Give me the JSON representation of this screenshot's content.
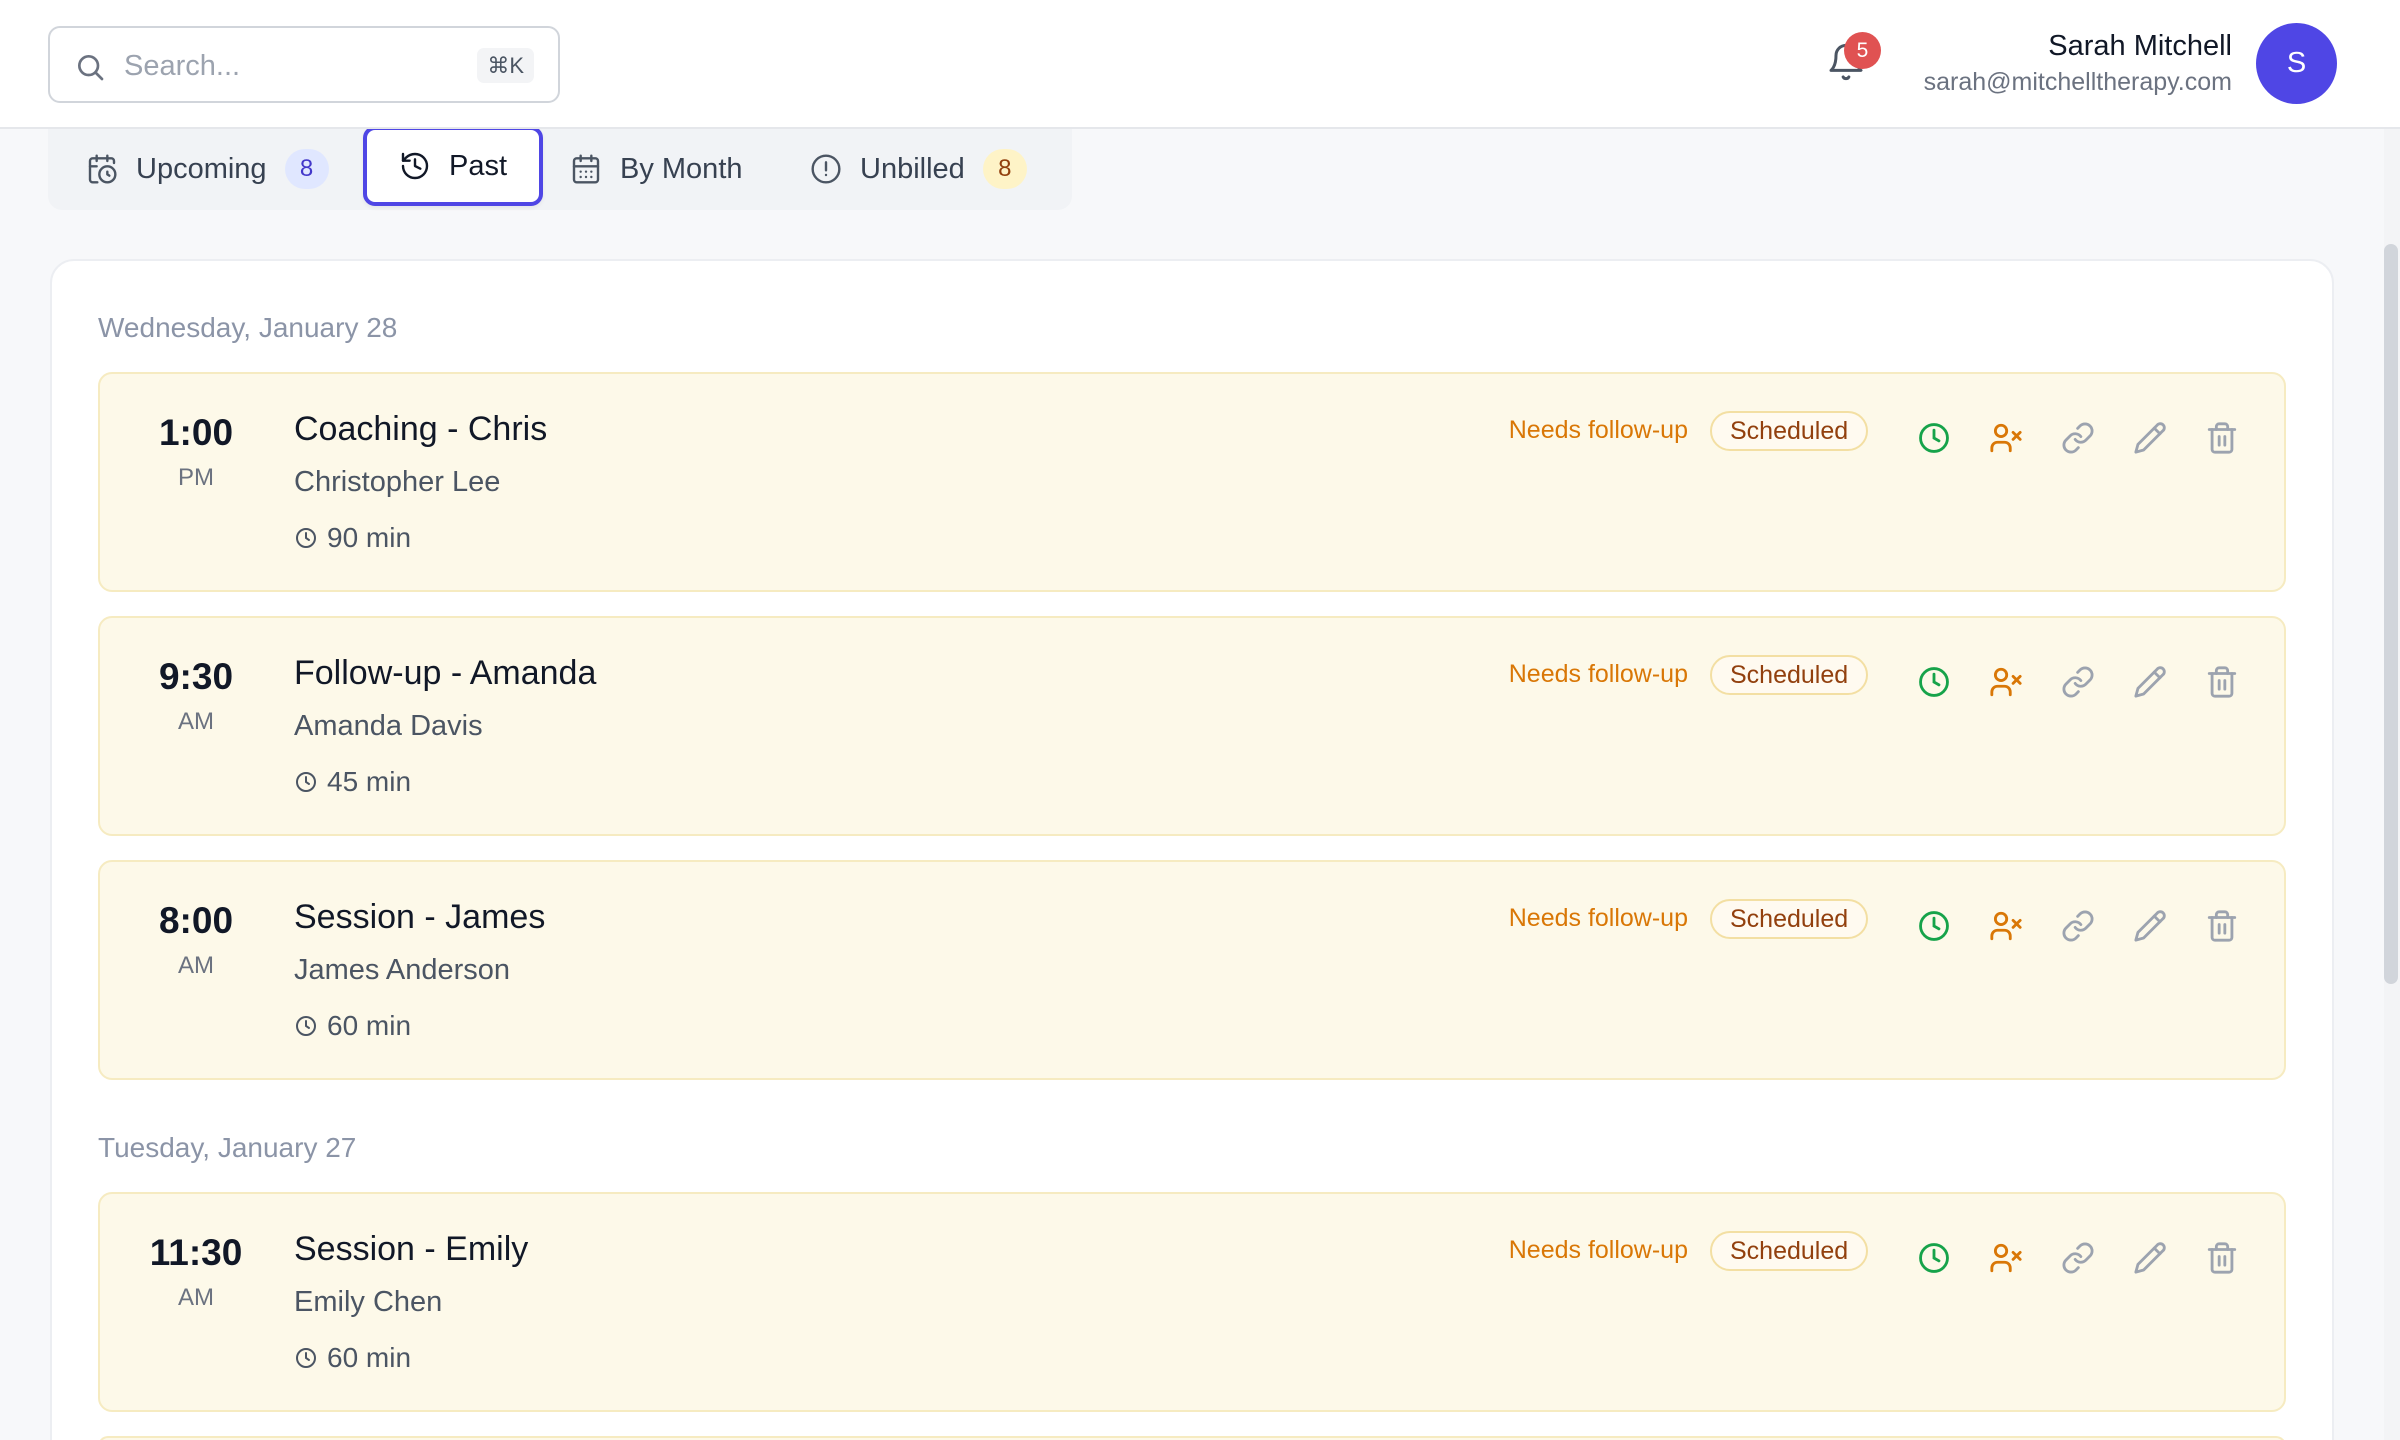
{
  "header": {
    "search_placeholder": "Search...",
    "search_shortcut": "⌘K",
    "notification_count": "5",
    "user_name": "Sarah Mitchell",
    "user_email": "sarah@mitchelltherapy.com",
    "avatar_initial": "S"
  },
  "tabs": [
    {
      "label": "Upcoming",
      "count": "8",
      "icon": "calendar-clock-icon"
    },
    {
      "label": "Past",
      "icon": "history-icon",
      "active": true
    },
    {
      "label": "By Month",
      "icon": "calendar-icon"
    },
    {
      "label": "Unbilled",
      "count": "8",
      "icon": "alert-circle-icon"
    }
  ],
  "groups": [
    {
      "date": "Wednesday, January 28",
      "sessions": [
        {
          "time": "1:00",
          "ampm": "PM",
          "title": "Coaching - Chris",
          "client": "Christopher Lee",
          "duration": "90 min",
          "flag": "Needs follow-up",
          "status": "Scheduled"
        },
        {
          "time": "9:30",
          "ampm": "AM",
          "title": "Follow-up - Amanda",
          "client": "Amanda Davis",
          "duration": "45 min",
          "flag": "Needs follow-up",
          "status": "Scheduled"
        },
        {
          "time": "8:00",
          "ampm": "AM",
          "title": "Session - James",
          "client": "James Anderson",
          "duration": "60 min",
          "flag": "Needs follow-up",
          "status": "Scheduled"
        }
      ]
    },
    {
      "date": "Tuesday, January 27",
      "sessions": [
        {
          "time": "11:30",
          "ampm": "AM",
          "title": "Session - Emily",
          "client": "Emily Chen",
          "duration": "60 min",
          "flag": "Needs follow-up",
          "status": "Scheduled"
        }
      ]
    }
  ],
  "colors": {
    "accent": "#4f46e5",
    "card_bg": "#fdf9e9",
    "warning": "#d97706",
    "success": "#16a34a",
    "notification": "#e05252"
  }
}
